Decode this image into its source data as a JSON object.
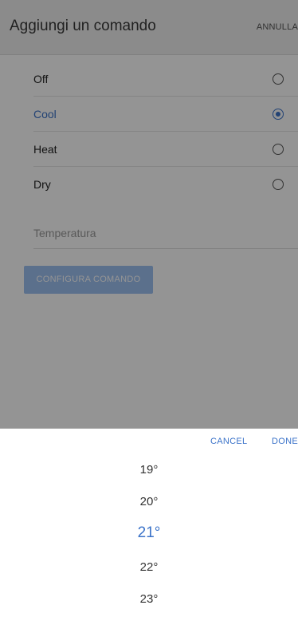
{
  "header": {
    "title": "Aggiungi un comando",
    "action_label": "ANNULLA"
  },
  "options": [
    {
      "label": "Off",
      "selected": false
    },
    {
      "label": "Cool",
      "selected": true
    },
    {
      "label": "Heat",
      "selected": false
    },
    {
      "label": "Dry",
      "selected": false
    }
  ],
  "temperature_field": {
    "placeholder": "Temperatura"
  },
  "configure_button": {
    "label": "CONFIGURA COMANDO"
  },
  "picker": {
    "cancel_label": "CANCEL",
    "done_label": "DONE",
    "values": [
      "19°",
      "20°",
      "21°",
      "22°",
      "23°"
    ],
    "selected_value": "21°"
  },
  "colors": {
    "accent": "#3b73c9",
    "button_disabled": "#9ec1f2",
    "header_bg": "#efefef"
  }
}
